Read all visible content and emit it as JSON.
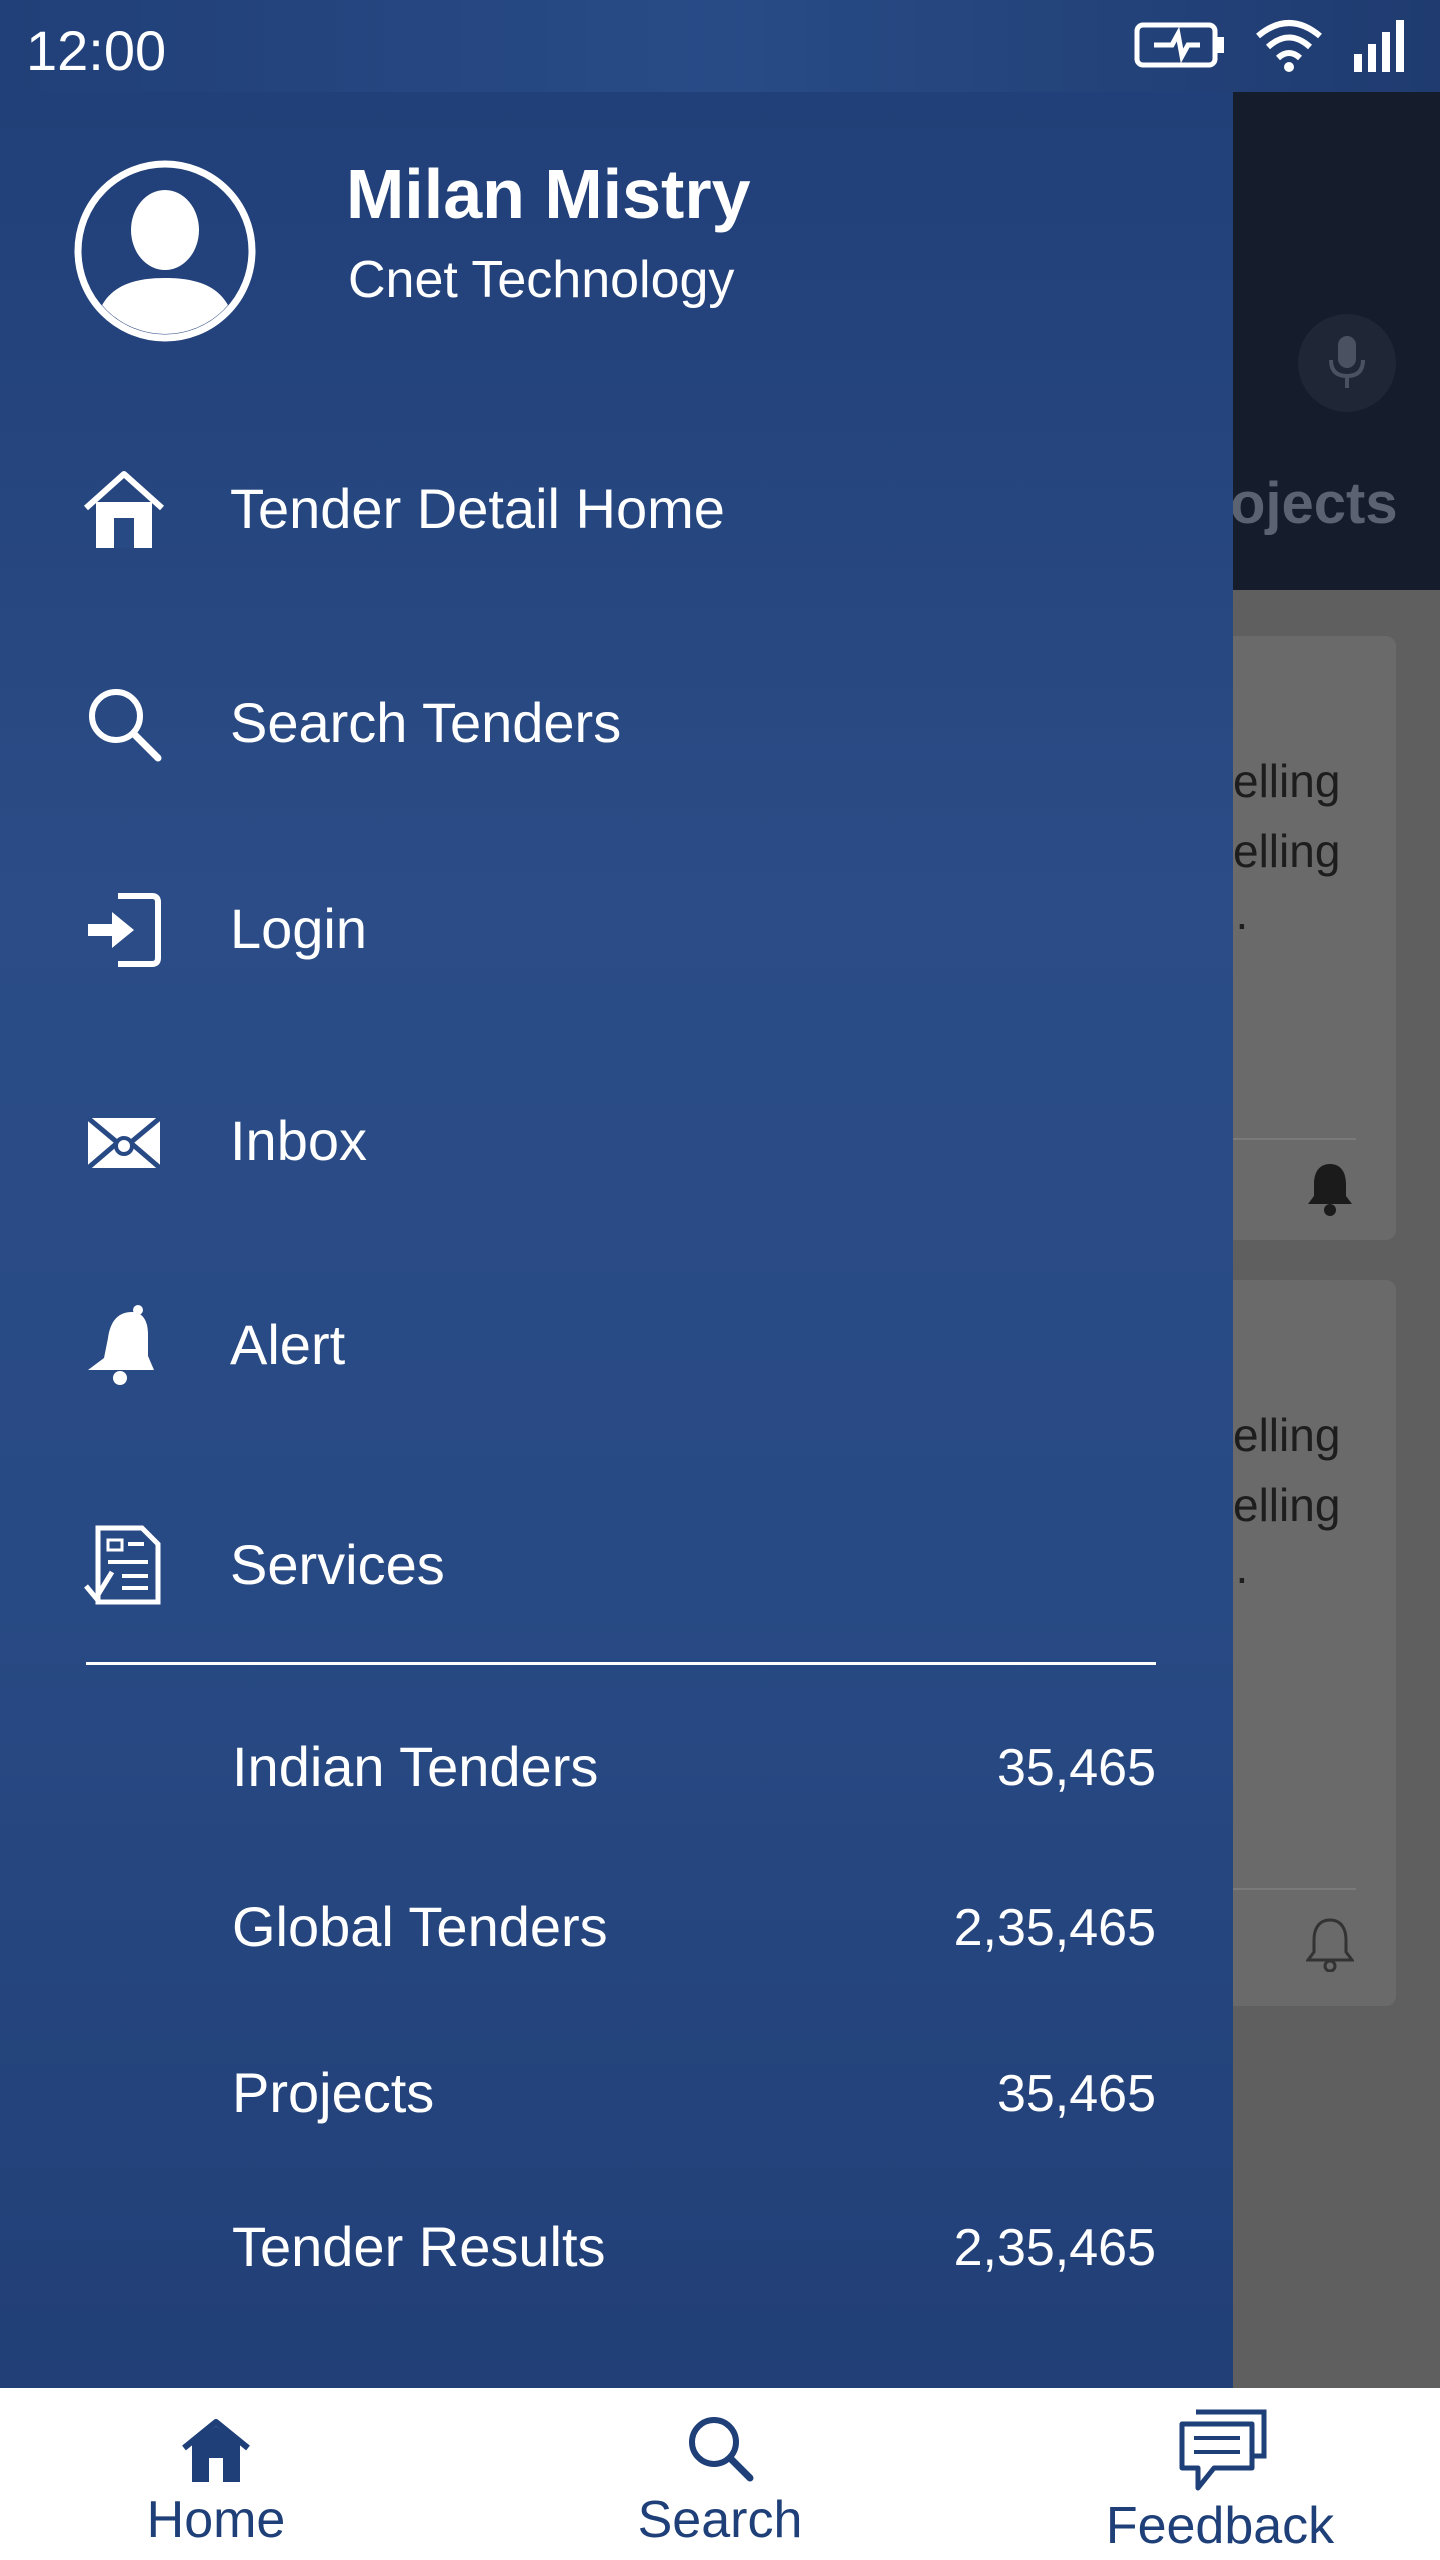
{
  "status_bar": {
    "time": "12:00",
    "icons": [
      "battery-charging-icon",
      "wifi-icon",
      "signal-icon"
    ]
  },
  "background": {
    "tab_partial": "ojects",
    "cards": [
      {
        "line1": "velling",
        "line2": "velling",
        "line3": "..."
      },
      {
        "line1": "velling",
        "line2": "velling",
        "line3": "..."
      }
    ]
  },
  "drawer": {
    "user": {
      "name": "Milan Mistry",
      "company": "Cnet Technology"
    },
    "menu": [
      {
        "label": "Tender Detail Home",
        "icon": "home-icon"
      },
      {
        "label": "Search Tenders",
        "icon": "search-icon"
      },
      {
        "label": "Login",
        "icon": "login-icon"
      },
      {
        "label": "Inbox",
        "icon": "envelope-icon"
      },
      {
        "label": "Alert",
        "icon": "bell-icon"
      },
      {
        "label": "Services",
        "icon": "services-icon"
      }
    ],
    "services": [
      {
        "label": "Indian Tenders",
        "count": "35,465"
      },
      {
        "label": "Global Tenders",
        "count": "2,35,465"
      },
      {
        "label": "Projects",
        "count": "35,465"
      },
      {
        "label": "Tender Results",
        "count": "2,35,465"
      }
    ]
  },
  "bottom_nav": {
    "items": [
      {
        "label": "Home",
        "icon": "home-icon"
      },
      {
        "label": "Search",
        "icon": "search-icon"
      },
      {
        "label": "Feedback",
        "icon": "feedback-icon"
      }
    ]
  },
  "colors": {
    "drawer": "#284b86",
    "nav_text": "#1e3f78",
    "scrim": "#5f5f5f"
  }
}
